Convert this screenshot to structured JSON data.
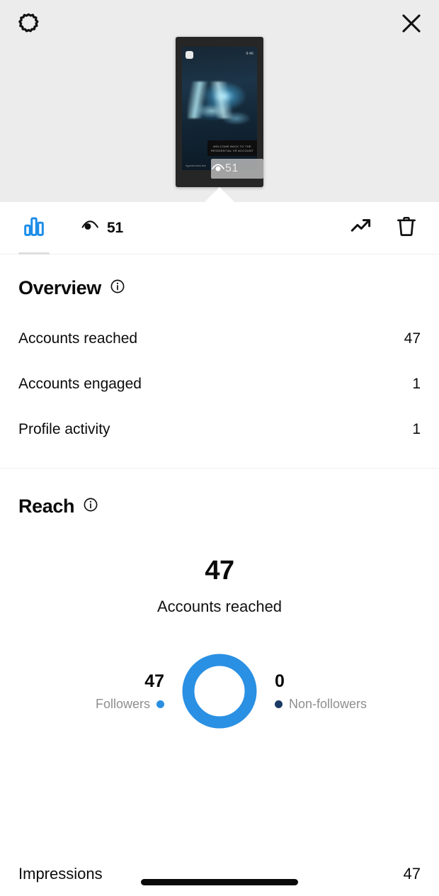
{
  "header": {
    "settings_icon": "gear-icon",
    "close_icon": "close-icon",
    "thumbnail": {
      "alt": "story-thumbnail",
      "time_label": "9:46",
      "handle_label": "hypertronics.live",
      "caption_line1": "WELCOME BACK TO THE",
      "caption_line2": "RESIDENTIAL VR ACCOUNT",
      "views_badge_value": "51",
      "views_badge_icon": "eye-icon"
    }
  },
  "toolbar": {
    "insights_tab_icon": "bar-chart-icon",
    "views_icon": "eye-icon",
    "views_count": "51",
    "promote_icon": "trending-up-icon",
    "delete_icon": "trash-icon"
  },
  "overview": {
    "title": "Overview",
    "info_icon": "info-icon",
    "rows": [
      {
        "label": "Accounts reached",
        "value": "47"
      },
      {
        "label": "Accounts engaged",
        "value": "1"
      },
      {
        "label": "Profile activity",
        "value": "1"
      }
    ]
  },
  "reach": {
    "title": "Reach",
    "info_icon": "info-icon",
    "hero_value": "47",
    "hero_label": "Accounts reached",
    "followers": {
      "value": "47",
      "label": "Followers",
      "color": "#2a8fe0"
    },
    "non_followers": {
      "value": "0",
      "label": "Non-followers",
      "color": "#1b3a64"
    }
  },
  "impressions": {
    "label": "Impressions",
    "value": "47"
  },
  "colors": {
    "accent_blue": "#1d8ee8",
    "donut_blue": "#2a90e3",
    "navy": "#1b3a64",
    "header_bg": "#ececec",
    "muted_text": "#8e8e8e"
  },
  "chart_data": {
    "type": "pie",
    "title": "Reach",
    "subtitle": "Accounts reached",
    "categories": [
      "Followers",
      "Non-followers"
    ],
    "values": [
      47,
      0
    ],
    "total": 47,
    "colors": [
      "#2a90e3",
      "#1b3a64"
    ],
    "legend_position": "sides",
    "donut": true
  }
}
